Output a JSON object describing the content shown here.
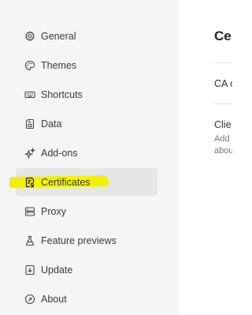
{
  "sidebar": {
    "items": [
      {
        "label": "General",
        "icon": "gear-icon"
      },
      {
        "label": "Themes",
        "icon": "palette-icon"
      },
      {
        "label": "Shortcuts",
        "icon": "keyboard-icon"
      },
      {
        "label": "Data",
        "icon": "database-icon"
      },
      {
        "label": "Add-ons",
        "icon": "sparkle-icon"
      },
      {
        "label": "Certificates",
        "icon": "certificate-icon",
        "selected": true
      },
      {
        "label": "Proxy",
        "icon": "server-icon"
      },
      {
        "label": "Feature previews",
        "icon": "flask-icon"
      },
      {
        "label": "Update",
        "icon": "download-icon"
      },
      {
        "label": "About",
        "icon": "info-icon"
      }
    ]
  },
  "main": {
    "title": "Ce",
    "ca_label": "CA c",
    "client_label": "Clie",
    "client_desc_line1": "Add",
    "client_desc_line2": "abou"
  },
  "colors": {
    "sidebar_bg": "#f5f5f5",
    "selected_bg": "#e6e6e6",
    "highlight": "#f2f200"
  }
}
